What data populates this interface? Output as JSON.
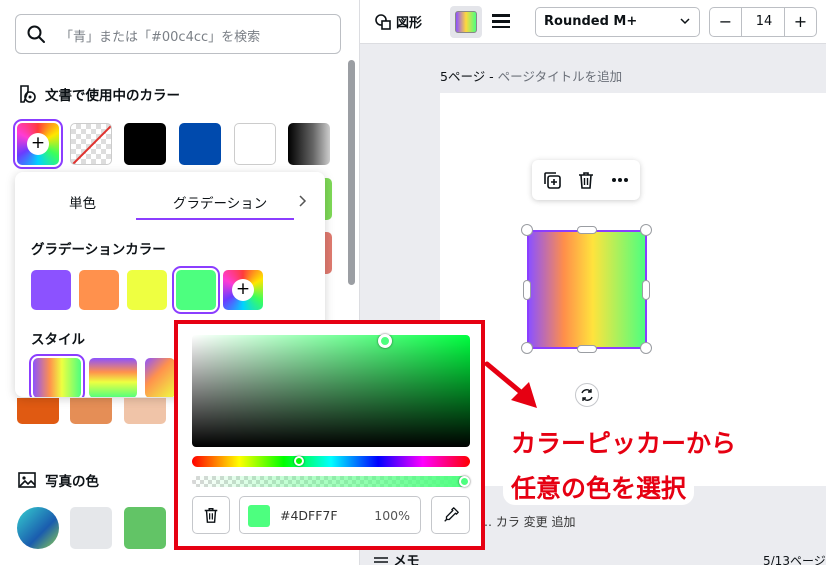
{
  "search": {
    "placeholder": "「青」または「#00c4cc」を検索"
  },
  "doc_colors": {
    "title": "文書で使用中のカラー",
    "swatches": [
      "add-color",
      "transparent",
      "#000000",
      "#004aad",
      "#ffffff",
      "gradient-black"
    ]
  },
  "popup": {
    "tabs": [
      "単色",
      "グラデーション"
    ],
    "active_tab": "グラデーション",
    "gradient_colors_title": "グラデーションカラー",
    "gradient_colors": [
      "#8c52ff",
      "#ff914d",
      "#eeff41",
      "#4dff7f"
    ],
    "style_title": "スタイル"
  },
  "photo_colors": {
    "title": "写真の色"
  },
  "toolbar": {
    "shape_label": "図形",
    "font_name": "Rounded M+",
    "font_size": "14",
    "minus": "−",
    "plus": "+"
  },
  "canvas": {
    "page_number": "5ページ",
    "page_title_placeholder": "ページタイトルを追加",
    "notes_label": "メモ",
    "page_count": "5/13ページ",
    "partial_text": "… カラ  変更   追加"
  },
  "picker": {
    "hex": "#4DFF7F",
    "opacity": "100%",
    "selected_color": "#4dff7f"
  },
  "annotation": {
    "line1": "カラーピッカーから",
    "line2": "任意の色を選択",
    "color": "#e60012"
  },
  "accent_color": "#8b3dff"
}
